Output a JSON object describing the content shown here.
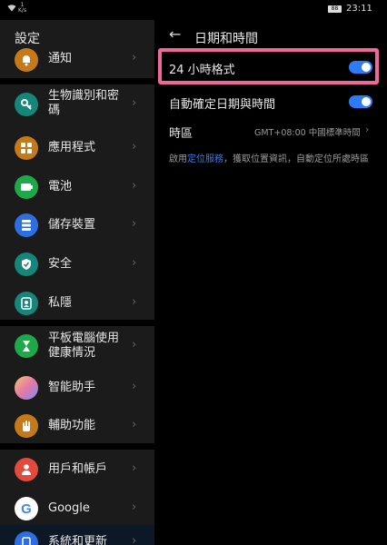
{
  "status_bar": {
    "wifi_icon": "wifi-icon",
    "rate_top": "1",
    "rate_bottom": "K/s",
    "battery": "88",
    "time": "23:11"
  },
  "sidebar": {
    "title": "設定",
    "items": [
      {
        "label": "通知",
        "icon": "bell-icon",
        "color": "#c57a1a"
      },
      {
        "label": "生物識別和密碼",
        "icon": "key-icon",
        "color": "#16867a"
      },
      {
        "label": "應用程式",
        "icon": "grid-icon",
        "color": "#c57a1a"
      },
      {
        "label": "電池",
        "icon": "battery-icon",
        "color": "#1fa84a"
      },
      {
        "label": "儲存裝置",
        "icon": "storage-icon",
        "color": "#2d6fe0"
      },
      {
        "label": "安全",
        "icon": "shield-check-icon",
        "color": "#16867a"
      },
      {
        "label": "私隱",
        "icon": "privacy-icon",
        "color": "#16867a"
      },
      {
        "label": "平板電腦使用健康情況",
        "icon": "hourglass-icon",
        "color": "#1fa84a"
      },
      {
        "label": "智能助手",
        "icon": "assistant-icon",
        "color": "#a98bd6"
      },
      {
        "label": "輔助功能",
        "icon": "hand-icon",
        "color": "#c57a1a"
      },
      {
        "label": "用戶和帳戶",
        "icon": "user-icon",
        "color": "#e24b3b"
      },
      {
        "label": "Google",
        "icon": "google-icon",
        "color": "#ffffff"
      },
      {
        "label": "系統和更新",
        "icon": "phone-icon",
        "color": "#2d6fe0"
      }
    ]
  },
  "detail": {
    "title": "日期和時間",
    "hour24_label": "24 小時格式",
    "hour24_on": true,
    "auto_label": "自動確定日期與時間",
    "auto_on": true,
    "timezone_label": "時區",
    "timezone_value": "GMT+08:00 中國標準時間",
    "note_prefix": "啟用",
    "note_link": "定位服務",
    "note_suffix": "，獲取位置資訊，自動定位所處時區",
    "accent": "#2f7bf6",
    "highlight_color": "#f0689b"
  }
}
